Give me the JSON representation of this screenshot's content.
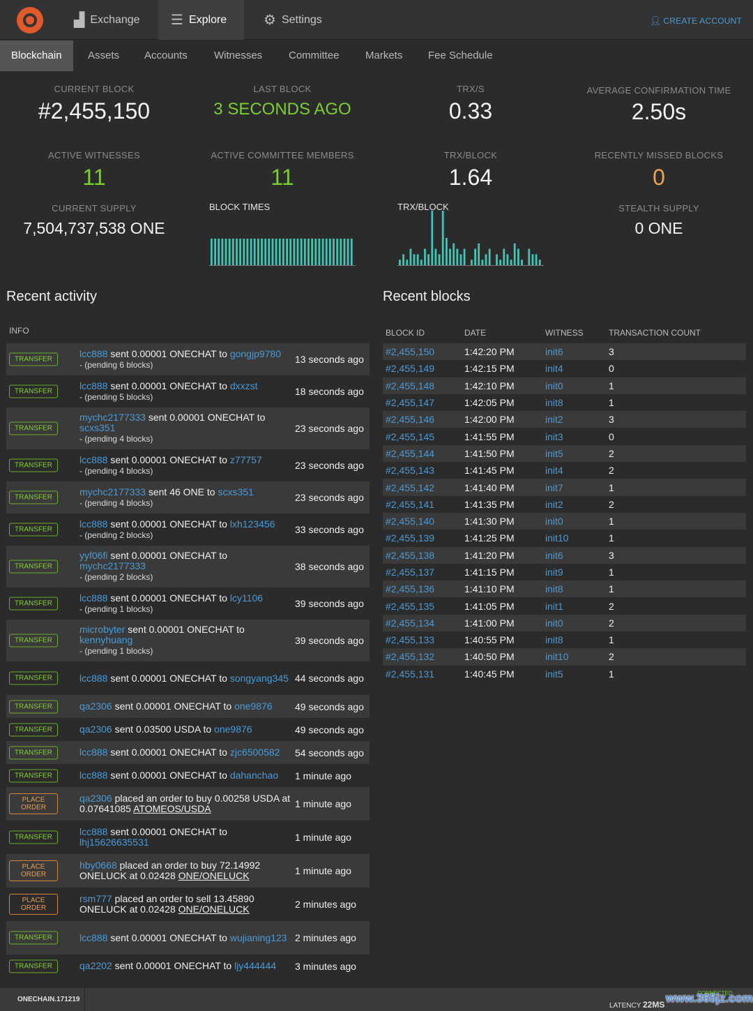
{
  "topnav": {
    "items": [
      {
        "label": "Exchange",
        "icon": "bar-chart-icon"
      },
      {
        "label": "Explore",
        "icon": "server-stack-icon"
      },
      {
        "label": "Settings",
        "icon": "gears-icon"
      }
    ],
    "create_account": "CREATE ACCOUNT"
  },
  "subnav": [
    "Blockchain",
    "Assets",
    "Accounts",
    "Witnesses",
    "Committee",
    "Markets",
    "Fee Schedule"
  ],
  "stats": {
    "current_block": {
      "label": "CURRENT BLOCK",
      "value": "#2,455,150"
    },
    "last_block": {
      "label": "LAST BLOCK",
      "value": "3 SECONDS AGO"
    },
    "trx_s": {
      "label": "TRX/S",
      "value": "0.33"
    },
    "avg_conf": {
      "label": "AVERAGE CONFIRMATION TIME",
      "value": "2.50s"
    },
    "active_witnesses": {
      "label": "ACTIVE WITNESSES",
      "value": "11"
    },
    "active_committee": {
      "label": "ACTIVE COMMITTEE MEMBERS",
      "value": "11"
    },
    "trx_block": {
      "label": "TRX/BLOCK",
      "value": "1.64"
    },
    "missed_blocks": {
      "label": "RECENTLY MISSED BLOCKS",
      "value": "0"
    },
    "current_supply": {
      "label": "CURRENT SUPPLY",
      "value": "7,504,737,538 ONE"
    },
    "stealth_supply": {
      "label": "STEALTH SUPPLY",
      "value": "0 ONE"
    }
  },
  "chart_data": [
    {
      "type": "bar",
      "title": "BLOCK TIMES",
      "values": [
        5,
        5,
        5,
        5,
        5,
        5,
        5,
        5,
        5,
        5,
        5,
        5,
        5,
        5,
        5,
        5,
        5,
        5,
        5,
        5,
        5,
        5,
        5,
        5,
        5,
        5,
        5,
        5,
        5,
        5,
        5,
        5,
        5,
        5,
        5,
        5,
        5,
        5,
        5,
        5
      ],
      "color": "#3fc6b4"
    },
    {
      "type": "bar",
      "title": "TRX/BLOCK",
      "values": [
        1,
        2,
        1,
        3,
        2,
        2,
        1,
        3,
        2,
        10,
        3,
        2,
        10,
        5,
        3,
        4,
        3,
        2,
        3,
        0,
        1,
        3,
        4,
        1,
        2,
        3,
        0,
        2,
        1,
        3,
        2,
        1,
        4,
        3,
        1,
        0,
        3,
        2,
        2,
        1
      ],
      "color": "#3fc6b4"
    }
  ],
  "activity": {
    "title": "Recent activity",
    "header": "INFO",
    "rows": [
      {
        "type": "TRANSFER",
        "user": "lcc888",
        "text": " sent 0.00001 ONECHAT to ",
        "target": "gongjp9780",
        "extra": "",
        "pending": "- (pending 6 blocks)",
        "time": "13 seconds ago"
      },
      {
        "type": "TRANSFER",
        "user": "lcc888",
        "text": " sent 0.00001 ONECHAT to ",
        "target": "dxxzst",
        "extra": "",
        "pending": "- (pending 5 blocks)",
        "time": "18 seconds ago"
      },
      {
        "type": "TRANSFER",
        "user": "mychc2177333",
        "text": " sent 0.00001 ONECHAT to ",
        "target": "scxs351",
        "extra": "",
        "pending": "- (pending 4 blocks)",
        "time": "23 seconds ago"
      },
      {
        "type": "TRANSFER",
        "user": "lcc888",
        "text": " sent 0.00001 ONECHAT to ",
        "target": "z77757",
        "extra": "",
        "pending": "- (pending 4 blocks)",
        "time": "23 seconds ago"
      },
      {
        "type": "TRANSFER",
        "user": "mychc2177333",
        "text": " sent 46 ONE to ",
        "target": "scxs351",
        "extra": "",
        "pending": "- (pending 4 blocks)",
        "time": "23 seconds ago"
      },
      {
        "type": "TRANSFER",
        "user": "lcc888",
        "text": " sent 0.00001 ONECHAT to ",
        "target": "lxh123456",
        "extra": "",
        "pending": "- (pending 2 blocks)",
        "time": "33 seconds ago"
      },
      {
        "type": "TRANSFER",
        "user": "yyf06fi",
        "text": " sent 0.00001 ONECHAT to ",
        "target": "mychc2177333",
        "extra": "",
        "pending": "- (pending 2 blocks)",
        "time": "38 seconds ago"
      },
      {
        "type": "TRANSFER",
        "user": "lcc888",
        "text": " sent 0.00001 ONECHAT to ",
        "target": "lcy1106",
        "extra": "",
        "pending": "- (pending 1 blocks)",
        "time": "39 seconds ago"
      },
      {
        "type": "TRANSFER",
        "user": "microbyter",
        "text": " sent 0.00001 ONECHAT to ",
        "target": "kennyhuang",
        "extra": "",
        "pending": "- (pending 1 blocks)",
        "time": "39 seconds ago"
      },
      {
        "type": "TRANSFER",
        "user": "lcc888",
        "text": " sent 0.00001 ONECHAT to ",
        "target": "songyang345",
        "extra": "",
        "pending": "",
        "time": "44 seconds ago"
      },
      {
        "type": "TRANSFER",
        "user": "qa2306",
        "text": " sent 0.00001 ONECHAT to ",
        "target": "one9876",
        "extra": "",
        "pending": "",
        "time": "49 seconds ago"
      },
      {
        "type": "TRANSFER",
        "user": "qa2306",
        "text": " sent 0.03500 USDA to ",
        "target": "one9876",
        "extra": "",
        "pending": "",
        "time": "49 seconds ago"
      },
      {
        "type": "TRANSFER",
        "user": "lcc888",
        "text": " sent 0.00001 ONECHAT to ",
        "target": "zjc6500582",
        "extra": "",
        "pending": "",
        "time": "54 seconds ago"
      },
      {
        "type": "TRANSFER",
        "user": "lcc888",
        "text": " sent 0.00001 ONECHAT to ",
        "target": "dahanchao",
        "extra": "",
        "pending": "",
        "time": "1 minute ago"
      },
      {
        "type": "PLACE ORDER",
        "user": "qa2306",
        "text": " placed an order to buy 0.00258 USDA at 0.07641085 ",
        "target": "",
        "extra": "ATOMEOS/USDA",
        "pending": "",
        "time": "1 minute ago"
      },
      {
        "type": "TRANSFER",
        "user": "lcc888",
        "text": " sent 0.00001 ONECHAT to ",
        "target": "lhj15626635531",
        "extra": "",
        "pending": "",
        "time": "1 minute ago"
      },
      {
        "type": "PLACE ORDER",
        "user": "hby0668",
        "text": " placed an order to buy 72.14992 ONELUCK at 0.02428 ",
        "target": "",
        "extra": "ONE/ONELUCK",
        "pending": "",
        "time": "1 minute ago"
      },
      {
        "type": "PLACE ORDER",
        "user": "rsm777",
        "text": " placed an order to sell 13.45890 ONELUCK at 0.02428 ",
        "target": "",
        "extra": "ONE/ONELUCK",
        "pending": "",
        "time": "2 minutes ago"
      },
      {
        "type": "TRANSFER",
        "user": "lcc888",
        "text": " sent 0.00001 ONECHAT to ",
        "target": "wujianing123",
        "extra": "",
        "pending": "",
        "time": "2 minutes ago"
      },
      {
        "type": "TRANSFER",
        "user": "qa2202",
        "text": " sent 0.00001 ONECHAT to ",
        "target": "ljy444444",
        "extra": "",
        "pending": "",
        "time": "3 minutes ago"
      }
    ]
  },
  "blocks": {
    "title": "Recent blocks",
    "headers": [
      "BLOCK ID",
      "DATE",
      "WITNESS",
      "TRANSACTION COUNT"
    ],
    "rows": [
      [
        "#2,455,150",
        "1:42:20 PM",
        "init6",
        "3"
      ],
      [
        "#2,455,149",
        "1:42:15 PM",
        "init4",
        "0"
      ],
      [
        "#2,455,148",
        "1:42:10 PM",
        "init0",
        "1"
      ],
      [
        "#2,455,147",
        "1:42:05 PM",
        "init8",
        "1"
      ],
      [
        "#2,455,146",
        "1:42:00 PM",
        "init2",
        "3"
      ],
      [
        "#2,455,145",
        "1:41:55 PM",
        "init3",
        "0"
      ],
      [
        "#2,455,144",
        "1:41:50 PM",
        "init5",
        "2"
      ],
      [
        "#2,455,143",
        "1:41:45 PM",
        "init4",
        "2"
      ],
      [
        "#2,455,142",
        "1:41:40 PM",
        "init7",
        "1"
      ],
      [
        "#2,455,141",
        "1:41:35 PM",
        "init2",
        "2"
      ],
      [
        "#2,455,140",
        "1:41:30 PM",
        "init0",
        "1"
      ],
      [
        "#2,455,139",
        "1:41:25 PM",
        "init10",
        "1"
      ],
      [
        "#2,455,138",
        "1:41:20 PM",
        "init6",
        "3"
      ],
      [
        "#2,455,137",
        "1:41:15 PM",
        "init9",
        "1"
      ],
      [
        "#2,455,136",
        "1:41:10 PM",
        "init8",
        "1"
      ],
      [
        "#2,455,135",
        "1:41:05 PM",
        "init1",
        "2"
      ],
      [
        "#2,455,134",
        "1:41:00 PM",
        "init0",
        "2"
      ],
      [
        "#2,455,133",
        "1:40:55 PM",
        "init8",
        "1"
      ],
      [
        "#2,455,132",
        "1:40:50 PM",
        "init10",
        "2"
      ],
      [
        "#2,455,131",
        "1:40:45 PM",
        "init5",
        "1"
      ]
    ]
  },
  "footer": {
    "version": "ONECHAIN.171219",
    "latency_label": "LATENCY",
    "latency_value": "22MS",
    "connection": "CONNECTED"
  },
  "watermark": "www.365jz.com"
}
